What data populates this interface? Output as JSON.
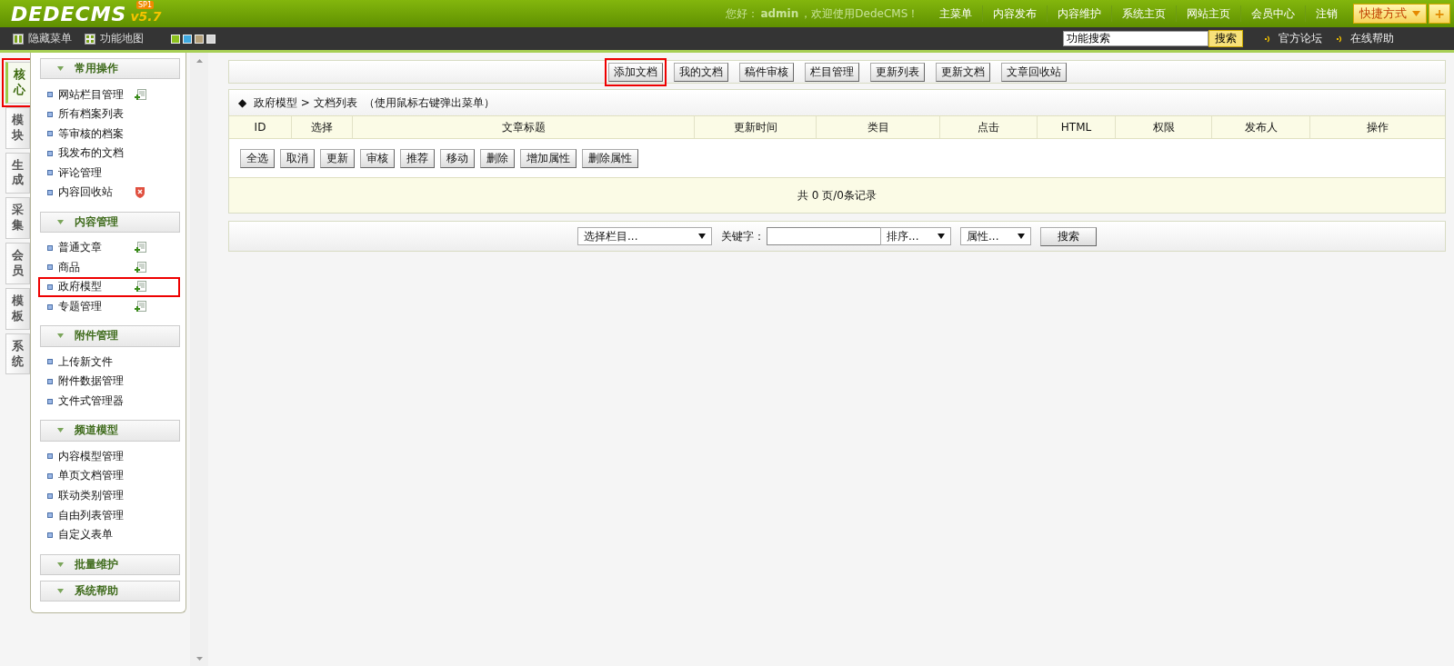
{
  "header": {
    "logo": "DEDECMS",
    "version": "v5.7",
    "badge": "SP1",
    "greeting": "您好：",
    "user": "admin",
    "welcome": "，欢迎使用DedeCMS！",
    "nav": [
      "主菜单",
      "内容发布",
      "内容维护",
      "系统主页",
      "网站主页",
      "会员中心",
      "注销"
    ],
    "shortcut": "快捷方式",
    "shortcut_add": "+"
  },
  "toolbar": {
    "hide_menu": "隐藏菜单",
    "function_map": "功能地图",
    "skins": [
      {
        "color": "#8dc21f"
      },
      {
        "color": "#3fa9e0"
      },
      {
        "color": "#b5a17a"
      },
      {
        "color": "#d6d6d6"
      }
    ],
    "search": {
      "value": "功能搜索",
      "button": "搜索"
    },
    "links": [
      "官方论坛",
      "在线帮助"
    ]
  },
  "side_tabs": [
    {
      "label": "核心",
      "selected": true,
      "highlighted": true
    },
    {
      "label": "模块",
      "selected": false,
      "highlighted": false
    },
    {
      "label": "生成",
      "selected": false,
      "highlighted": false
    },
    {
      "label": "采集",
      "selected": false,
      "highlighted": false
    },
    {
      "label": "会员",
      "selected": false,
      "highlighted": false
    },
    {
      "label": "模板",
      "selected": false,
      "highlighted": false
    },
    {
      "label": "系统",
      "selected": false,
      "highlighted": false
    }
  ],
  "sidebar": {
    "groups": [
      {
        "title": "常用操作",
        "items": [
          {
            "label": "网站栏目管理",
            "kind": "add",
            "highlighted": false
          },
          {
            "label": "所有档案列表",
            "kind": "plain",
            "highlighted": false
          },
          {
            "label": "等审核的档案",
            "kind": "plain",
            "highlighted": false
          },
          {
            "label": "我发布的文档",
            "kind": "plain",
            "highlighted": false
          },
          {
            "label": "评论管理",
            "kind": "plain",
            "highlighted": false
          },
          {
            "label": "内容回收站",
            "kind": "trash",
            "highlighted": false
          }
        ]
      },
      {
        "title": "内容管理",
        "items": [
          {
            "label": "普通文章",
            "kind": "add",
            "highlighted": false
          },
          {
            "label": "商品",
            "kind": "add",
            "highlighted": false
          },
          {
            "label": "政府模型",
            "kind": "add",
            "highlighted": true
          },
          {
            "label": "专题管理",
            "kind": "add",
            "highlighted": false
          }
        ]
      },
      {
        "title": "附件管理",
        "items": [
          {
            "label": "上传新文件",
            "kind": "plain",
            "highlighted": false
          },
          {
            "label": "附件数据管理",
            "kind": "plain",
            "highlighted": false
          },
          {
            "label": "文件式管理器",
            "kind": "plain",
            "highlighted": false
          }
        ]
      },
      {
        "title": "频道模型",
        "items": [
          {
            "label": "内容模型管理",
            "kind": "plain",
            "highlighted": false
          },
          {
            "label": "单页文档管理",
            "kind": "plain",
            "highlighted": false
          },
          {
            "label": "联动类别管理",
            "kind": "plain",
            "highlighted": false
          },
          {
            "label": "自由列表管理",
            "kind": "plain",
            "highlighted": false
          },
          {
            "label": "自定义表单",
            "kind": "plain",
            "highlighted": false
          }
        ]
      },
      {
        "title": "批量维护"
      },
      {
        "title": "系统帮助"
      }
    ]
  },
  "actions": [
    {
      "label": "添加文档",
      "highlighted": true
    },
    {
      "label": "我的文档",
      "highlighted": false
    },
    {
      "label": "稿件审核",
      "highlighted": false
    },
    {
      "label": "栏目管理",
      "highlighted": false
    },
    {
      "label": "更新列表",
      "highlighted": false
    },
    {
      "label": "更新文档",
      "highlighted": false
    },
    {
      "label": "文章回收站",
      "highlighted": false
    }
  ],
  "list": {
    "marker": "◆",
    "breadcrumb": [
      "政府模型",
      "文档列表"
    ],
    "separator": ">",
    "hint": "（使用鼠标右键弹出菜单）",
    "columns": [
      "ID",
      "选择",
      "文章标题",
      "更新时间",
      "类目",
      "点击",
      "HTML",
      "权限",
      "发布人",
      "操作"
    ],
    "buttons": [
      "全选",
      "取消",
      "更新",
      "审核",
      "推荐",
      "移动",
      "删除",
      "增加属性",
      "删除属性"
    ],
    "pager": "共 0 页/0条记录"
  },
  "filter": {
    "category": "选择栏目...",
    "keyword_label": "关键字：",
    "sort": "排序...",
    "attribute": "属性...",
    "button": "搜索"
  }
}
